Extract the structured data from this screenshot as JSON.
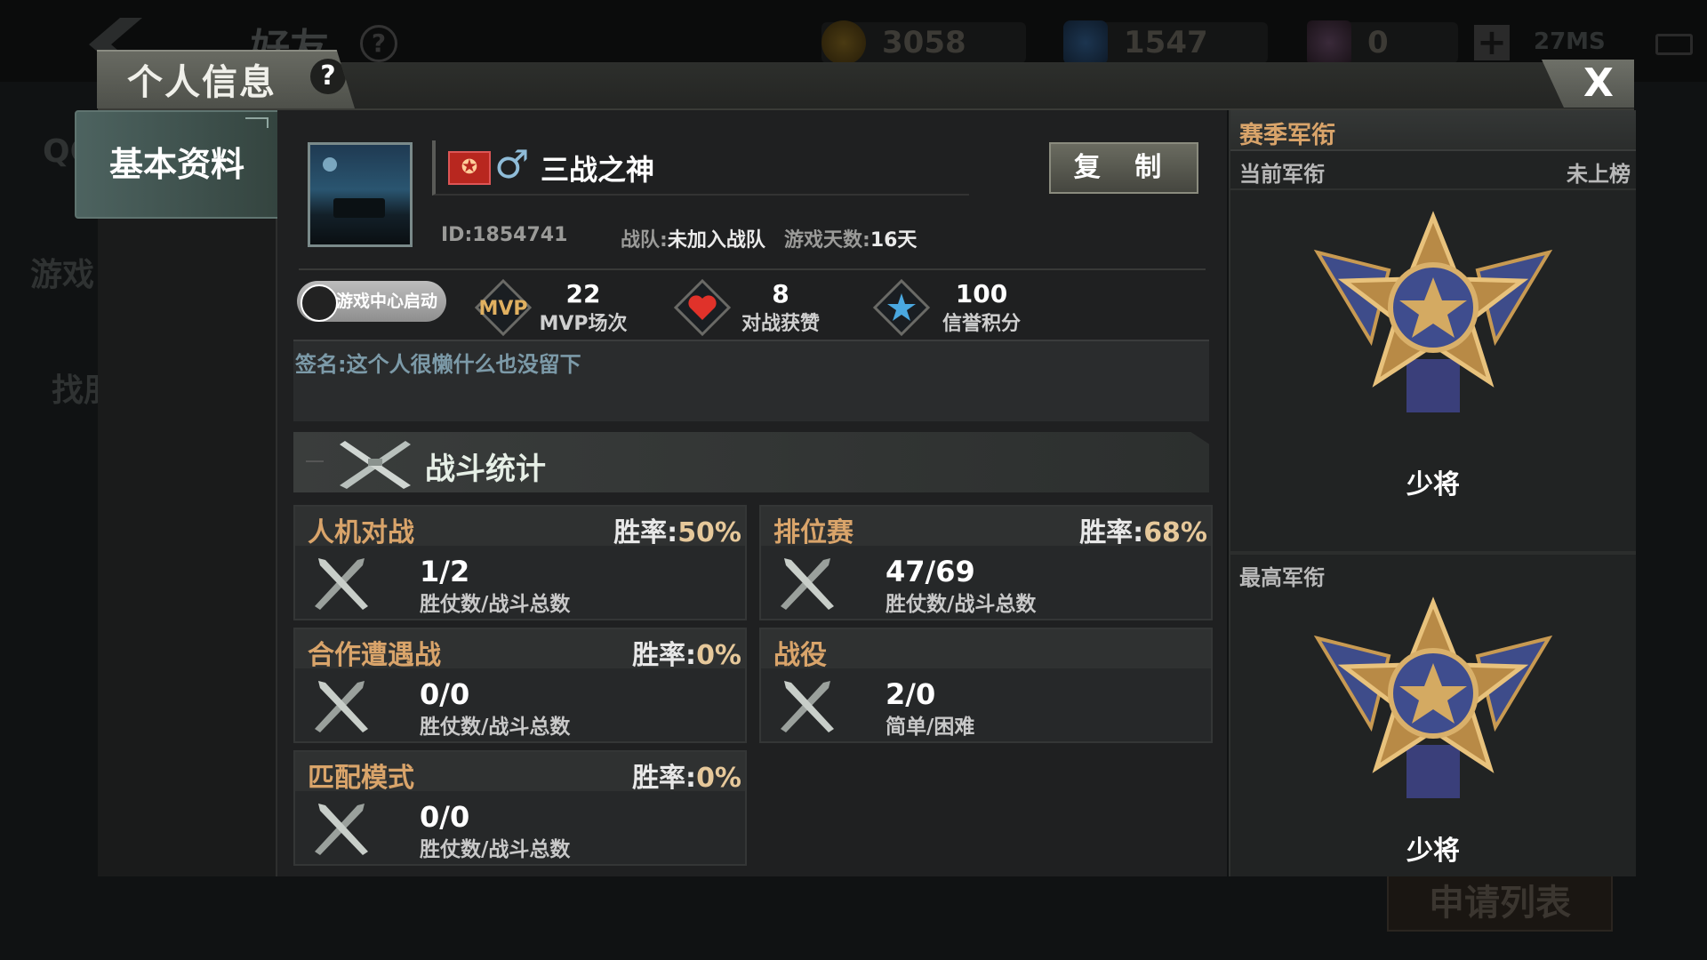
{
  "background": {
    "screen_title": "好友",
    "help_mark": "?",
    "gold": "3058",
    "diamond": "1547",
    "ticket": "0",
    "ping": "27MS",
    "side_labels": [
      "QQ",
      "游戏",
      "找朋"
    ],
    "apply_list": "申请列表"
  },
  "dialog": {
    "title": "个人信息",
    "help": "?",
    "close": "X",
    "nav": {
      "basic_info": "基本资料"
    }
  },
  "profile": {
    "player_name": "三战之神",
    "gender_symbol": "♂",
    "copy_button": "复 制",
    "id": "ID:1854741",
    "team_label": "战队:",
    "team_value": "未加入战队",
    "days_label": "游戏天数:",
    "days_value": "16天",
    "qq_launch": "游戏中心启动",
    "stats": [
      {
        "icon": "mvp-icon",
        "value": "22",
        "label": "MVP场次"
      },
      {
        "icon": "heart-icon",
        "value": "8",
        "label": "对战获赞"
      },
      {
        "icon": "star-icon",
        "value": "100",
        "label": "信誉积分"
      }
    ],
    "signature": "签名:这个人很懒什么也没留下"
  },
  "battle_stats": {
    "title": "战斗统计",
    "modes": [
      {
        "name": "人机对战",
        "rate_label": "胜率:",
        "rate": "50%",
        "value": "1/2",
        "sub": "胜仗数/战斗总数"
      },
      {
        "name": "排位赛",
        "rate_label": "胜率:",
        "rate": "68%",
        "value": "47/69",
        "sub": "胜仗数/战斗总数"
      },
      {
        "name": "合作遭遇战",
        "rate_label": "胜率:",
        "rate": "0%",
        "value": "0/0",
        "sub": "胜仗数/战斗总数"
      },
      {
        "name": "战役",
        "rate_label": "",
        "rate": "",
        "value": "2/0",
        "sub": "简单/困难"
      },
      {
        "name": "匹配模式",
        "rate_label": "胜率:",
        "rate": "0%",
        "value": "0/0",
        "sub": "胜仗数/战斗总数"
      }
    ]
  },
  "rank": {
    "season_title": "赛季军衔",
    "current_label": "当前军衔",
    "current_status": "未上榜",
    "current_rank": "少将",
    "highest_label": "最高军衔",
    "highest_rank": "少将"
  },
  "colors": {
    "accent_gold": "#d9a46a",
    "nav_teal": "#4d6360",
    "panel_bg": "#1f2021"
  }
}
